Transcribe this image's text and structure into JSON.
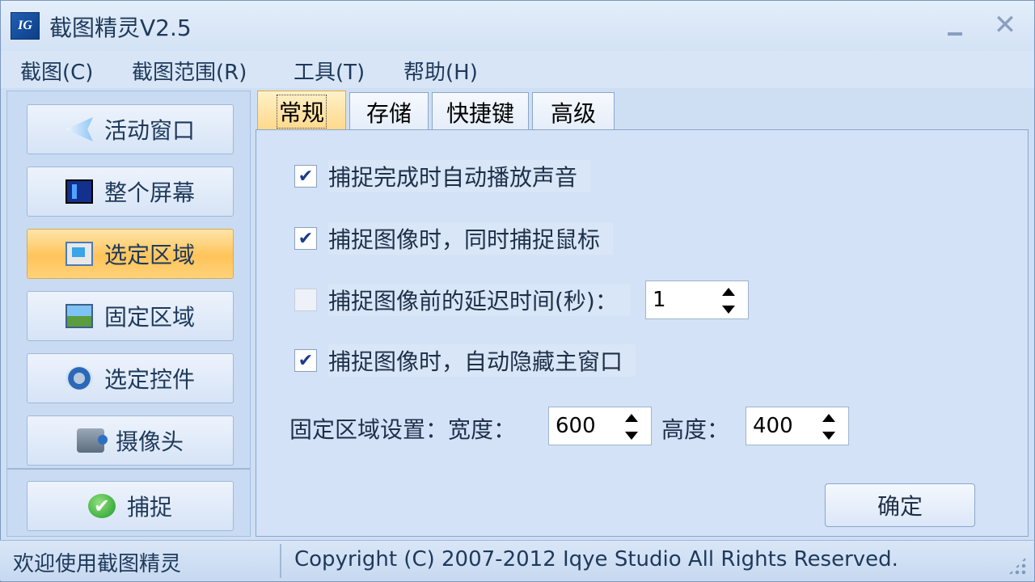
{
  "window": {
    "title": "截图精灵V2.5",
    "icon_text": "IG",
    "minimize_icon": "minimize-icon",
    "close_glyph": "✕"
  },
  "menu": [
    {
      "label": "截图(C)"
    },
    {
      "label": "截图范围(R)"
    },
    {
      "label": "工具(T)"
    },
    {
      "label": "帮助(H)"
    }
  ],
  "sidebar": {
    "items": [
      {
        "label": "活动窗口",
        "icon": "active-window-icon"
      },
      {
        "label": "整个屏幕",
        "icon": "full-screen-icon"
      },
      {
        "label": "选定区域",
        "icon": "select-region-icon",
        "active": true
      },
      {
        "label": "固定区域",
        "icon": "fixed-region-icon"
      },
      {
        "label": "选定控件",
        "icon": "select-control-icon"
      },
      {
        "label": "摄像头",
        "icon": "camera-icon"
      }
    ],
    "capture_label": "捕捉",
    "capture_icon": "check-icon",
    "capture_glyph": "✔"
  },
  "tabs": [
    {
      "label": "常规",
      "active": true
    },
    {
      "label": "存储"
    },
    {
      "label": "快捷键"
    },
    {
      "label": "高级"
    }
  ],
  "general": {
    "options": [
      {
        "label": "捕捉完成时自动播放声音",
        "checked": true
      },
      {
        "label": "捕捉图像时，同时捕捉鼠标",
        "checked": true
      },
      {
        "label": "捕捉图像前的延迟时间(秒)：",
        "checked": false
      },
      {
        "label": "捕捉图像时，自动隐藏主窗口",
        "checked": true
      }
    ],
    "check_glyph": "✔",
    "delay_value": "1",
    "fixed_label": "固定区域设置：宽度：",
    "width_value": "600",
    "height_label": "高度：",
    "height_value": "400",
    "ok_label": "确定"
  },
  "status": {
    "left": "欢迎使用截图精灵",
    "right": "Copyright (C) 2007-2012 Iqye Studio All Rights Reserved."
  }
}
